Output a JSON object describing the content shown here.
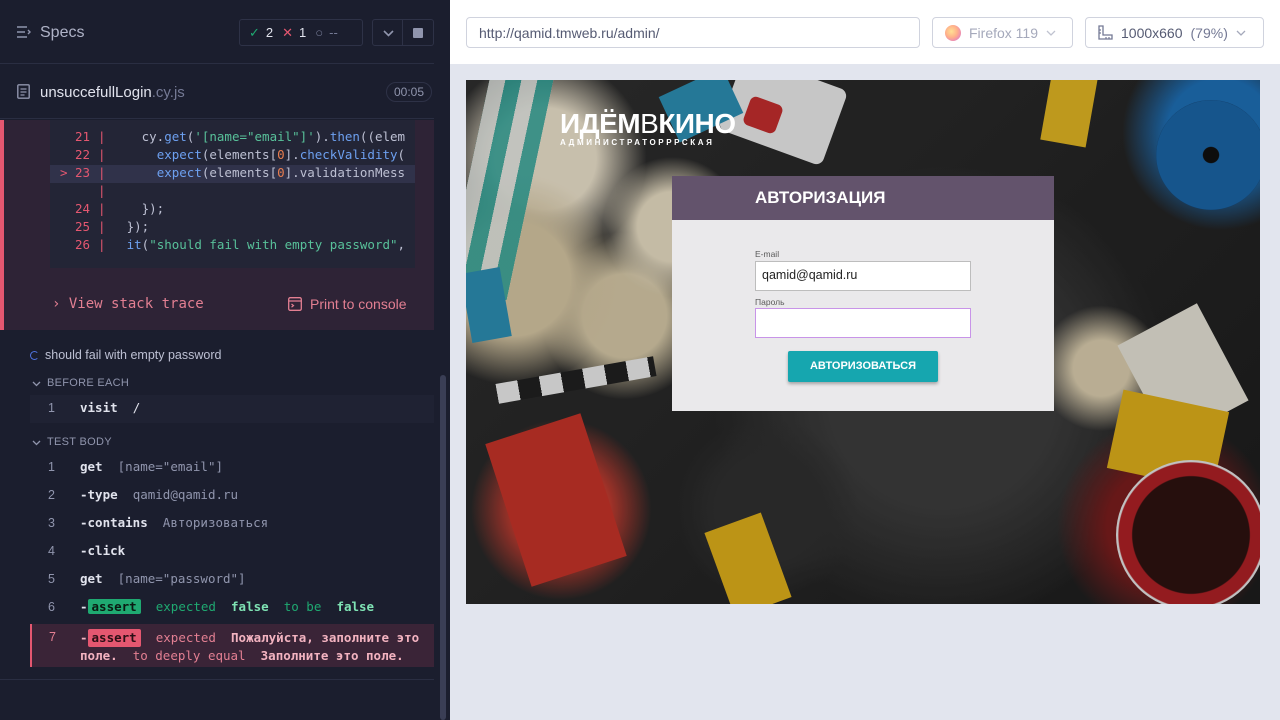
{
  "reporter": {
    "header": {
      "title": "Specs",
      "stats": {
        "passed": "2",
        "failed": "1",
        "pending": "--"
      }
    },
    "spec": {
      "name": "unsuccefullLogin",
      "ext": ".cy.js",
      "duration": "00:05"
    },
    "code_frame": {
      "lines": [
        {
          "num": "21",
          "text": "    cy.get('[name=\"email\"]').then((elem"
        },
        {
          "num": "22",
          "text": "      expect(elements[0].checkValidity("
        },
        {
          "num": "23",
          "text": "      expect(elements[0].validationMess"
        },
        {
          "num": "24",
          "text": "    });"
        },
        {
          "num": "25",
          "text": "  });"
        },
        {
          "num": "26",
          "text": "  it(\"should fail with empty password\","
        }
      ],
      "highlight_marker": ">"
    },
    "view_stack_trace": "View stack trace",
    "print_to_console": "Print to console",
    "test_title": "should fail with empty password",
    "before_each": {
      "label": "BEFORE EACH",
      "commands": [
        {
          "num": "1",
          "name": "visit",
          "arg": "/"
        }
      ]
    },
    "test_body": {
      "label": "TEST BODY",
      "commands": [
        {
          "num": "1",
          "name": "get",
          "arg": "[name=\"email\"]"
        },
        {
          "num": "2",
          "name": "-type",
          "arg": "qamid@qamid.ru"
        },
        {
          "num": "3",
          "name": "-contains",
          "arg": "Авторизоваться"
        },
        {
          "num": "4",
          "name": "-click",
          "arg": ""
        },
        {
          "num": "5",
          "name": "get",
          "arg": "[name=\"password\"]"
        }
      ],
      "assert_pass": {
        "num": "6",
        "prefix": "-",
        "badge": "assert",
        "w1": "expected",
        "v1": "false",
        "w2": "to be",
        "v2": "false"
      },
      "assert_fail": {
        "num": "7",
        "prefix": "-",
        "badge": "assert",
        "w1": "expected",
        "v1": "Пожалуйста, заполните это поле.",
        "w2": "to deeply equal",
        "v2": "Заполните это поле."
      }
    }
  },
  "aut": {
    "url": "http://qamid.tmweb.ru/admin/",
    "browser": "Firefox 119",
    "viewport": "1000x660",
    "zoom": "(79%)",
    "page": {
      "logo_main_1": "ИДЁМ",
      "logo_main_2": "В",
      "logo_main_3": "КИНО",
      "logo_sub": "АДМИНИСТРАТОРРРСКАЯ",
      "auth_title": "АВТОРИЗАЦИЯ",
      "email_label": "E-mail",
      "email_value": "qamid@qamid.ru",
      "password_label": "Пароль",
      "password_value": "",
      "submit_label": "АВТОРИЗОВАТЬСЯ"
    }
  },
  "colors": {
    "reporter_bg": "#1b1e2e",
    "fail": "#e45770",
    "pass": "#1fa971",
    "auth_header": "#63536c",
    "auth_button": "#16a6af"
  }
}
